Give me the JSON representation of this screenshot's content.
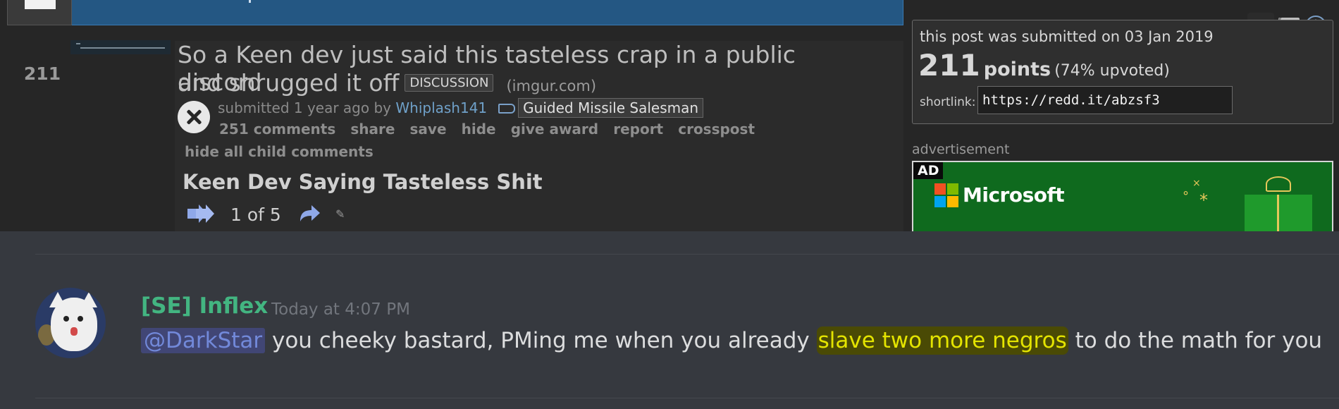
{
  "post": {
    "rank": "211",
    "title_line1": "So a Keen dev just said this tasteless crap in a public discord",
    "title_line2": "and shrugged it off",
    "flair": "DISCUSSION",
    "domain": "(imgur.com)",
    "submitted_prefix": "submitted 1 year ago by",
    "author": "Whiplash141",
    "user_flair": "Guided Missile Salesman",
    "actions": [
      "251 comments",
      "share",
      "save",
      "hide",
      "give award",
      "report",
      "crosspost"
    ],
    "hide_children": "hide all child comments",
    "album_title": "Keen Dev Saying Tasteless Shit",
    "album_position": "1 of 5",
    "album_link_glyph": "✎"
  },
  "sidebar": {
    "submitted_on": "this post was submitted on 03 Jan 2019",
    "points_value": "211",
    "points_word": "points",
    "upvoted": "(74% upvoted)",
    "shortlink_label": "shortlink:",
    "shortlink_value": "https://redd.it/abzsf3",
    "ad_label": "advertisement",
    "ad_tag": "AD",
    "ad_brand": "Microsoft",
    "ms_colors": [
      "#f25022",
      "#7fba00",
      "#00a4ef",
      "#ffb900"
    ]
  },
  "icons": {
    "close": "close-icon",
    "tag": "tag-icon",
    "prev": "double-arrow-icon",
    "next": "forward-arrow-icon",
    "mail": "mail-icon",
    "up": "arrow-up-circle-icon"
  },
  "discord": {
    "username": "[SE] Inflex",
    "timestamp": "Today at 4:07 PM",
    "mention": "@DarkStar",
    "message_part1": " you cheeky bastard, PMing me when you already ",
    "highlighted": "slave two more negros",
    "message_part2": " to do the math for you",
    "colors": {
      "username": "#43b581",
      "mention": "#7289da",
      "highlight": "#e4e400"
    }
  }
}
